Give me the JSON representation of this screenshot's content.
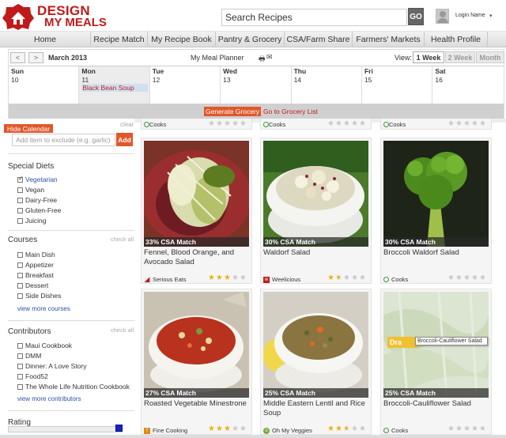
{
  "header": {
    "logo_line1": "DESIGN",
    "logo_line2": "MY MEALS",
    "search_placeholder": "Search Recipes",
    "search_button": "GO",
    "login_name": "Login Name",
    "login_caret": "▾"
  },
  "nav": [
    {
      "label": "Home",
      "width": 0
    },
    {
      "label": "Recipe Match"
    },
    {
      "label": "My Recipe Book"
    },
    {
      "label": "Pantry & Grocery"
    },
    {
      "label": "CSA/Farm Share"
    },
    {
      "label": "Farmers' Markets"
    },
    {
      "label": "Health Profile"
    }
  ],
  "calendar": {
    "prev": "<",
    "next": ">",
    "month": "March 2013",
    "title": "My Meal Planner",
    "view_label": "View:",
    "view_1week": "1 Week",
    "view_2week": "2 Week",
    "view_month": "Month",
    "days": [
      {
        "name": "Sun",
        "num": "10",
        "meal": ""
      },
      {
        "name": "Mon",
        "num": "11",
        "meal": "Black Bean Soup"
      },
      {
        "name": "Tue",
        "num": "12",
        "meal": ""
      },
      {
        "name": "Wed",
        "num": "13",
        "meal": ""
      },
      {
        "name": "Thu",
        "num": "14",
        "meal": ""
      },
      {
        "name": "Fri",
        "num": "15",
        "meal": ""
      },
      {
        "name": "Sat",
        "num": "16",
        "meal": ""
      }
    ],
    "generate_grocery": "Generate Grocery",
    "goto_grocery": "Go to Grocery List"
  },
  "sidebar": {
    "hide_calendar": "Hide Calendar",
    "clear": "clear",
    "exclude_placeholder": "Add item to exclude (e.g. garlic)",
    "exclude_add": "Add",
    "special_diets": {
      "heading": "Special Diets",
      "items": [
        {
          "label": "Vegetarian",
          "checked": true
        },
        {
          "label": "Vegan",
          "checked": false
        },
        {
          "label": "Dairy-Free",
          "checked": false
        },
        {
          "label": "Gluten-Free",
          "checked": false
        },
        {
          "label": "Juicing",
          "checked": false
        }
      ]
    },
    "courses": {
      "heading": "Courses",
      "check_all": "check all",
      "items": [
        "Main Dish",
        "Appetizer",
        "Breakfast",
        "Dessert",
        "Side Dishes"
      ],
      "more": "view more courses"
    },
    "contributors": {
      "heading": "Contributors",
      "check_all": "check all",
      "items": [
        "Maui Cookbook",
        "DMM",
        "Dinner: A Love Story",
        "Food52",
        "The Whole Life Nutrition Cookbook"
      ],
      "more": "view more contributors"
    },
    "rating": {
      "heading": "Rating"
    }
  },
  "partial_row": [
    {
      "source": "Cooks",
      "stars": 0
    },
    {
      "source": "Cooks",
      "stars": 0
    },
    {
      "source": "Cooks",
      "stars": 0
    }
  ],
  "recipes": [
    {
      "match": "33% CSA Match",
      "title": "Fennel, Blood Orange, and Avocado Salad",
      "source": "Serious Eats",
      "stars": 3
    },
    {
      "match": "30% CSA Match",
      "title": "Waldorf Salad",
      "source": "Weelicious",
      "stars": 1.5
    },
    {
      "match": "30% CSA Match",
      "title": "Broccoli Waldorf Salad",
      "source": "Cooks",
      "stars": 0
    },
    {
      "match": "27% CSA Match",
      "title": "Roasted Vegetable Minestrone",
      "source": "Fine Cooking",
      "stars": 3
    },
    {
      "match": "25% CSA Match",
      "title": "Middle Eastern Lentil and Rice Soup",
      "source": "Oh My Veggies",
      "stars": 2.5
    },
    {
      "match": "25% CSA Match",
      "title": "Broccoli-Cauliflower Salad",
      "source": "Cooks",
      "stars": 0,
      "drag_label": "Dra",
      "tooltip": "Broccoli-Cauliflower Salad"
    }
  ],
  "colors": {
    "brand_red": "#c01a1a",
    "accent_orange": "#e0582a",
    "link_blue": "#2a52a5",
    "star_gold": "#e8b21a"
  },
  "icons": [
    "logo-badge-icon",
    "print-icon",
    "mail-icon",
    "avatar-icon",
    "star-icon",
    "source-icon"
  ]
}
